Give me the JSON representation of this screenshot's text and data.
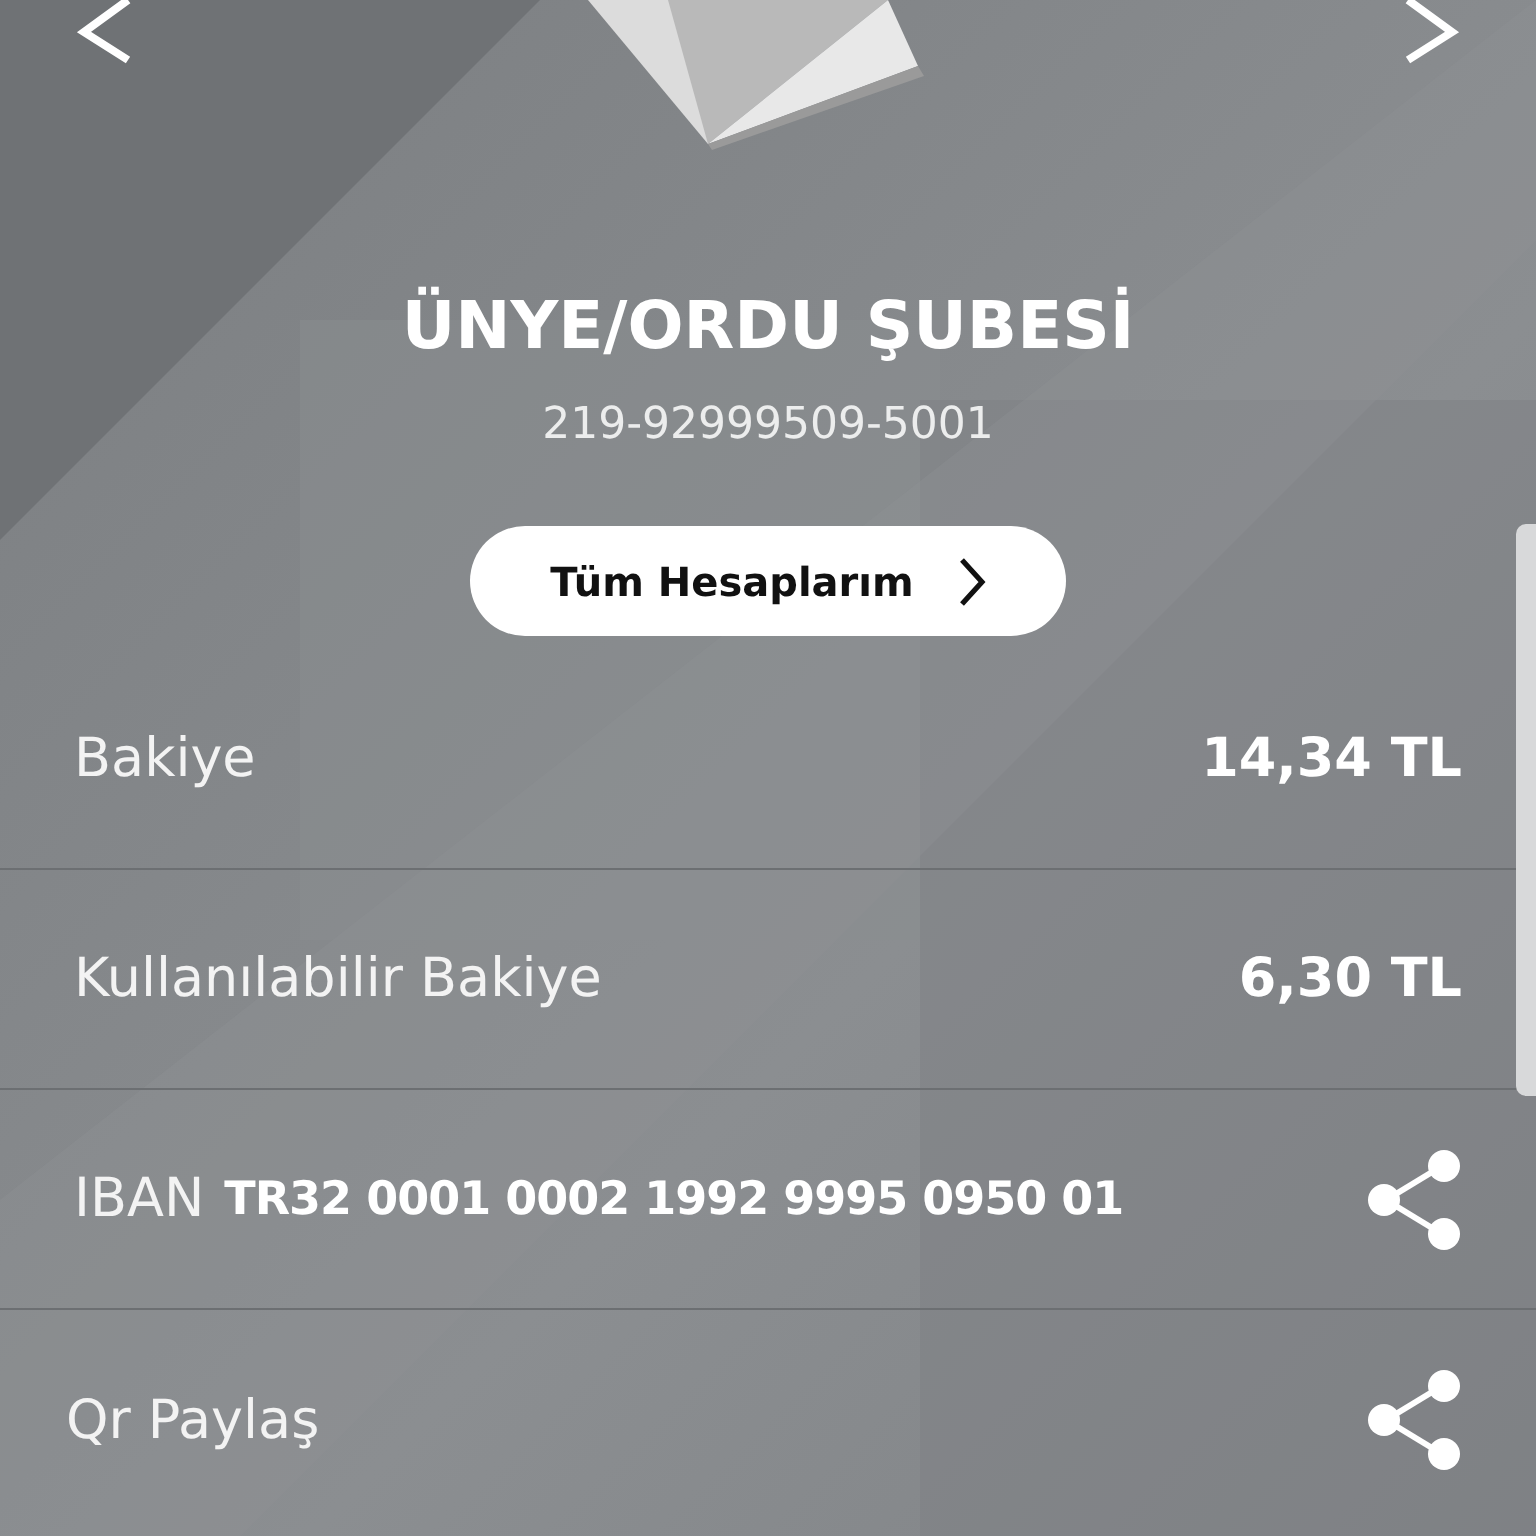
{
  "account": {
    "branch": "ÜNYE/ORDU ŞUBESİ",
    "number": "219-92999509-5001"
  },
  "all_accounts_button": {
    "label": "Tüm Hesaplarım"
  },
  "rows": [
    {
      "kind": "amount",
      "label": "Bakiye",
      "value": "14,34 TL"
    },
    {
      "kind": "amount",
      "label": "Kullanılabilir Bakiye",
      "value": "6,30 TL"
    },
    {
      "kind": "iban",
      "label": "IBAN",
      "value": "TR32 0001 0002 1992 9995 0950 01"
    },
    {
      "kind": "share",
      "label": "Qr Paylaş"
    }
  ]
}
